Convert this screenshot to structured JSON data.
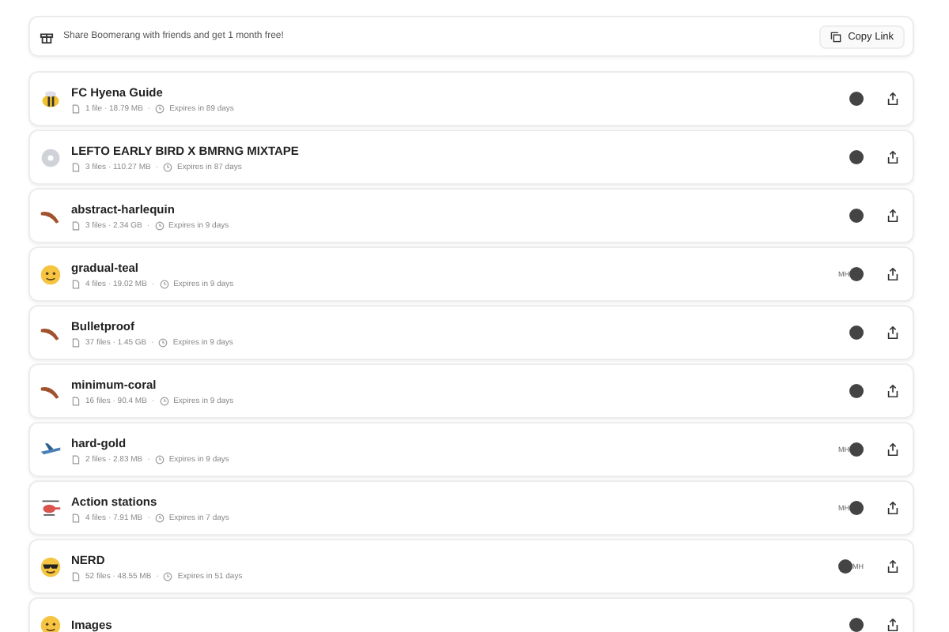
{
  "banner": {
    "text": "Share Boomerang with friends and get 1 month free!",
    "button": "Copy Link"
  },
  "transfers": [
    {
      "kind": "bee",
      "title": "FC Hyena Guide",
      "summary": "1 file · 18.79 MB",
      "separator": "·",
      "expires": "Expires in 89 days",
      "avatars": [
        {
          "kind": "photo"
        }
      ]
    },
    {
      "kind": "disc",
      "title": "LEFTO EARLY BIRD X BMRNG MIXTAPE",
      "summary": "3 files · 110.27 MB",
      "separator": "·",
      "expires": "Expires in 87 days",
      "avatars": [
        {
          "kind": "photo"
        }
      ]
    },
    {
      "kind": "boomerang",
      "title": "abstract-harlequin",
      "summary": "3 files · 2.34 GB",
      "separator": "·",
      "expires": "Expires in 9 days",
      "avatars": [
        {
          "kind": "photo"
        }
      ]
    },
    {
      "kind": "face",
      "title": "gradual-teal",
      "summary": "4 files · 19.02 MB",
      "separator": "·",
      "expires": "Expires in 9 days",
      "avatars": [
        {
          "kind": "initials",
          "text": "MH"
        },
        {
          "kind": "photo"
        }
      ]
    },
    {
      "kind": "boomerang",
      "title": "Bulletproof",
      "summary": "37 files · 1.45 GB",
      "separator": "·",
      "expires": "Expires in 9 days",
      "avatars": [
        {
          "kind": "photo"
        }
      ]
    },
    {
      "kind": "boomerang",
      "title": "minimum-coral",
      "summary": "16 files · 90.4 MB",
      "separator": "·",
      "expires": "Expires in 9 days",
      "avatars": [
        {
          "kind": "photo"
        }
      ]
    },
    {
      "kind": "plane",
      "title": "hard-gold",
      "summary": "2 files · 2.83 MB",
      "separator": "·",
      "expires": "Expires in 9 days",
      "avatars": [
        {
          "kind": "initials",
          "text": "MH"
        },
        {
          "kind": "photo"
        }
      ]
    },
    {
      "kind": "helicopter",
      "title": "Action stations",
      "summary": "4 files · 7.91 MB",
      "separator": "·",
      "expires": "Expires in 7 days",
      "avatars": [
        {
          "kind": "initials",
          "text": "MH"
        },
        {
          "kind": "photo"
        }
      ]
    },
    {
      "kind": "sunglasses",
      "title": "NERD",
      "summary": "52 files · 48.55 MB",
      "separator": "·",
      "expires": "Expires in 51 days",
      "avatars": [
        {
          "kind": "photo"
        },
        {
          "kind": "initials",
          "text": "MH"
        }
      ]
    },
    {
      "kind": "face",
      "title": "Images",
      "avatars": [
        {
          "kind": "photo"
        }
      ]
    }
  ]
}
